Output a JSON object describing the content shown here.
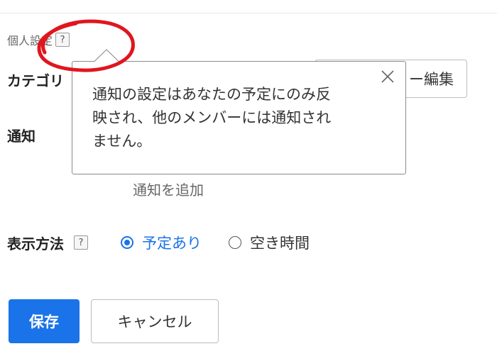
{
  "personal_settings": {
    "label": "個人設定",
    "help_glyph": "?"
  },
  "category": {
    "label": "カテゴリ",
    "edit_button": "ー編集"
  },
  "notification": {
    "label": "通知",
    "add_link": "通知を追加"
  },
  "tooltip": {
    "line1": "通知の設定はあなたの予定にのみ反",
    "line2": "映され、他のメンバーには通知され",
    "line3": "ません。"
  },
  "display": {
    "label": "表示方法",
    "help_glyph": "?",
    "options": [
      {
        "label": "予定あり",
        "selected": true
      },
      {
        "label": "空き時間",
        "selected": false
      }
    ]
  },
  "actions": {
    "save": "保存",
    "cancel": "キャンセル"
  },
  "colors": {
    "accent": "#1a73e8",
    "annotation": "#e0161e"
  },
  "icons": {
    "tooltip_close": "close-icon",
    "help": "question-icon"
  }
}
